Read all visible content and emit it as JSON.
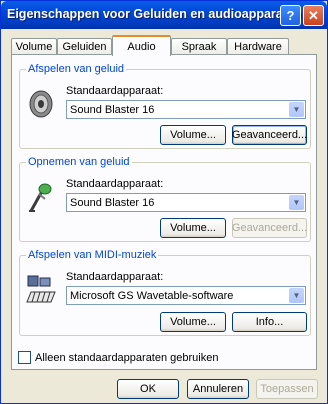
{
  "window": {
    "title": "Eigenschappen voor Geluiden en audioapparaten",
    "help_label": "?",
    "close_label": "✕"
  },
  "tabs": [
    {
      "label": "Volume"
    },
    {
      "label": "Geluiden"
    },
    {
      "label": "Audio",
      "active": true
    },
    {
      "label": "Spraak"
    },
    {
      "label": "Hardware"
    }
  ],
  "groups": {
    "playback": {
      "title": "Afspelen van geluid",
      "device_label": "Standaardapparaat:",
      "device_value": "Sound Blaster 16",
      "volume_label": "Volume...",
      "advanced_label": "Geavanceerd...",
      "icon": "speaker-icon"
    },
    "recording": {
      "title": "Opnemen van geluid",
      "device_label": "Standaardapparaat:",
      "device_value": "Sound Blaster 16",
      "volume_label": "Volume...",
      "advanced_label": "Geavanceerd...",
      "icon": "microphone-icon"
    },
    "midi": {
      "title": "Afspelen van MIDI-muziek",
      "device_label": "Standaardapparaat:",
      "device_value": "Microsoft GS Wavetable-software",
      "volume_label": "Volume...",
      "info_label": "Info...",
      "icon": "midi-keyboard-icon"
    }
  },
  "default_only_checkbox": {
    "label": "Alleen standaardapparaten gebruiken",
    "checked": false
  },
  "footer": {
    "ok_label": "OK",
    "cancel_label": "Annuleren",
    "apply_label": "Toepassen"
  },
  "colors": {
    "title_blue": "#0048d6",
    "group_title": "#0046d5",
    "tab_accent": "#e68b2c",
    "dialog_bg": "#ece9d8"
  }
}
